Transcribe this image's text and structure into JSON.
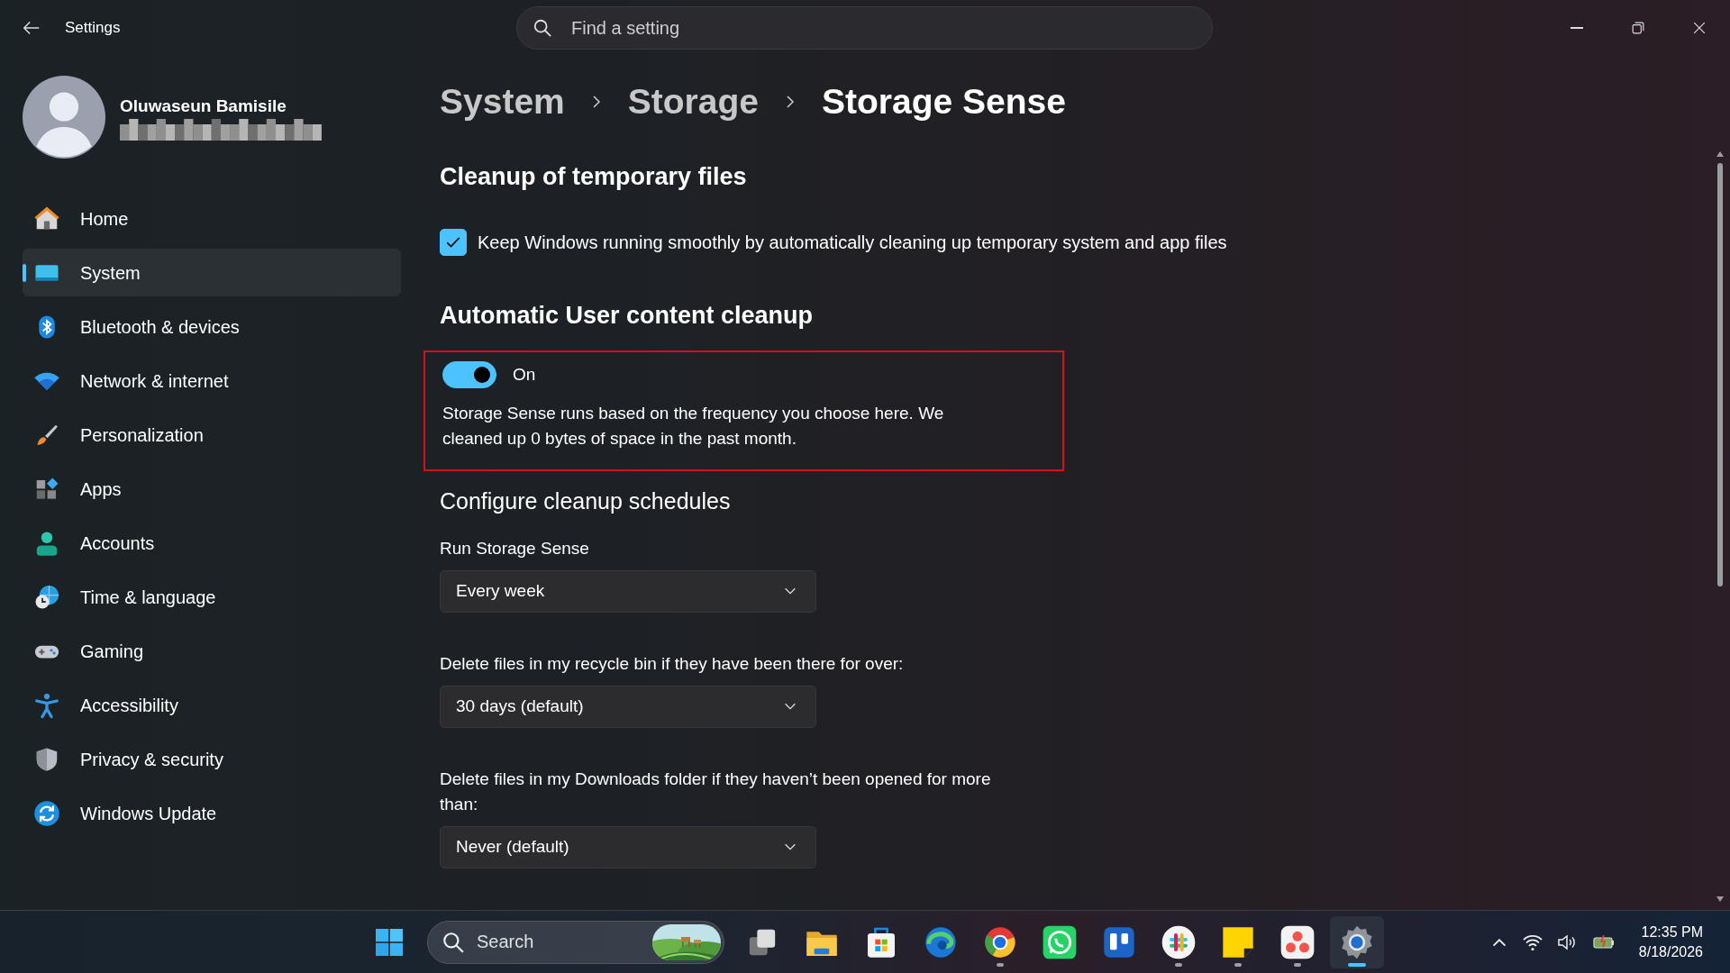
{
  "window": {
    "title": "Settings"
  },
  "search": {
    "placeholder": "Find a setting"
  },
  "user": {
    "name": "Oluwaseun Bamisile"
  },
  "sidebar": {
    "items": [
      {
        "label": "Home",
        "selected": false
      },
      {
        "label": "System",
        "selected": true
      },
      {
        "label": "Bluetooth & devices",
        "selected": false
      },
      {
        "label": "Network & internet",
        "selected": false
      },
      {
        "label": "Personalization",
        "selected": false
      },
      {
        "label": "Apps",
        "selected": false
      },
      {
        "label": "Accounts",
        "selected": false
      },
      {
        "label": "Time & language",
        "selected": false
      },
      {
        "label": "Gaming",
        "selected": false
      },
      {
        "label": "Accessibility",
        "selected": false
      },
      {
        "label": "Privacy & security",
        "selected": false
      },
      {
        "label": "Windows Update",
        "selected": false
      }
    ]
  },
  "breadcrumb": [
    "System",
    "Storage",
    "Storage Sense"
  ],
  "temp_cleanup": {
    "heading": "Cleanup of temporary files",
    "checkbox": {
      "label": "Keep Windows running smoothly by automatically cleaning up temporary system and app files",
      "checked": true
    }
  },
  "user_cleanup": {
    "heading": "Automatic User content cleanup",
    "highlighted": true,
    "toggle": {
      "label": "On",
      "on": true
    },
    "description": "Storage Sense runs based on the frequency you choose here. We cleaned up 0 bytes of space in the past month."
  },
  "schedules": {
    "heading": "Configure cleanup schedules",
    "settings": [
      {
        "label": "Run Storage Sense",
        "value": "Every week"
      },
      {
        "label": "Delete files in my recycle bin if they have been there for over:",
        "value": "30 days (default)"
      },
      {
        "label": "Delete files in my Downloads folder if they haven’t been opened for more than:",
        "value": "Never (default)"
      }
    ]
  },
  "taskbar": {
    "search_placeholder": "Search",
    "apps": [
      {
        "running": false,
        "selected": false
      },
      {
        "running": false,
        "selected": false
      },
      {
        "running": false,
        "selected": false
      },
      {
        "running": false,
        "selected": false
      },
      {
        "running": true,
        "selected": false
      },
      {
        "running": false,
        "selected": false
      },
      {
        "running": false,
        "selected": false
      },
      {
        "running": true,
        "selected": false
      },
      {
        "running": true,
        "selected": false
      },
      {
        "running": true,
        "selected": false
      },
      {
        "running": true,
        "selected": true
      }
    ],
    "time": "12:35 PM",
    "date": "8/18/2026"
  }
}
